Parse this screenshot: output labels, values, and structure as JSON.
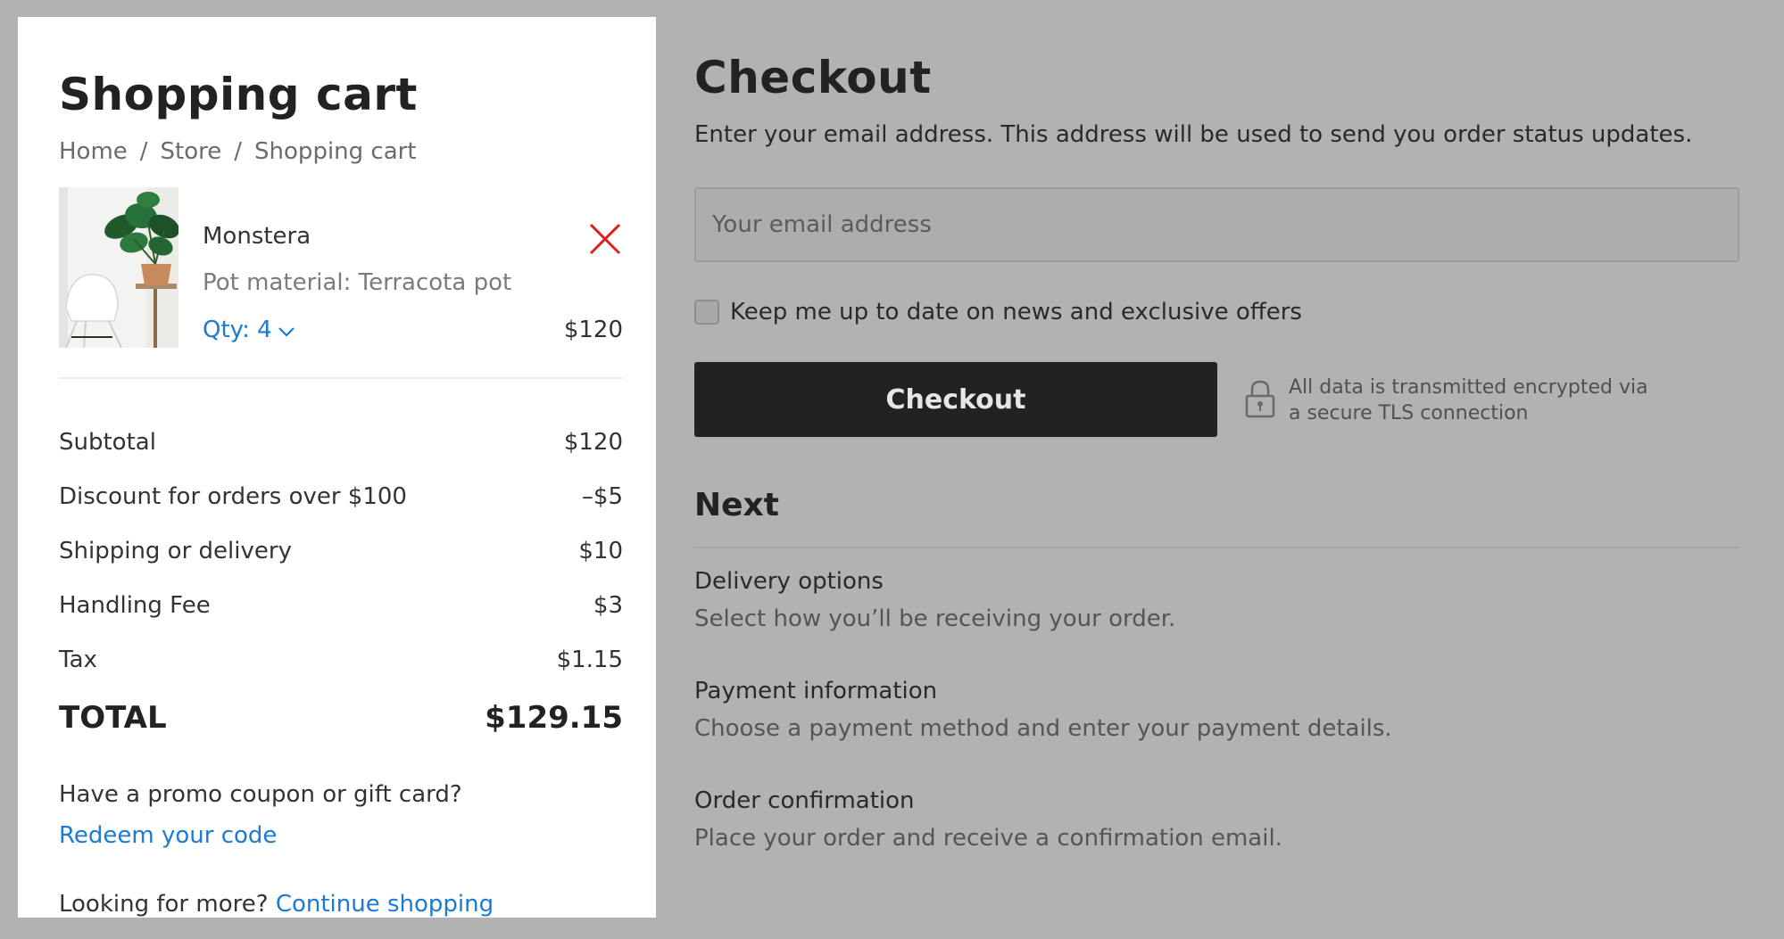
{
  "cart": {
    "title": "Shopping cart",
    "breadcrumb": [
      "Home",
      "Store",
      "Shopping cart"
    ],
    "breadcrumb_separator": "/",
    "item": {
      "name": "Monstera",
      "meta": "Pot material: Terracota pot",
      "qty": "Qty: 4",
      "price": "$120",
      "image": "monstera-plant-photo"
    },
    "summary": [
      {
        "label": "Subtotal",
        "value": "$120"
      },
      {
        "label": "Discount for orders over $100",
        "value": "–$5"
      },
      {
        "label": "Shipping or delivery",
        "value": "$10"
      },
      {
        "label": "Handling Fee",
        "value": "$3"
      },
      {
        "label": "Tax",
        "value": "$1.15"
      }
    ],
    "total": {
      "label": "TOTAL",
      "value": "$129.15"
    },
    "promo_question": "Have a promo coupon or gift card?",
    "redeem_link": "Redeem your code",
    "more_text": "Looking for more?",
    "continue_link": "Continue shopping"
  },
  "checkout": {
    "title": "Checkout",
    "description": "Enter your email address. This address will be used to send you order status updates.",
    "email_placeholder": "Your email address",
    "email_value": "",
    "newsletter_label": "Keep me up to date on news and exclusive offers",
    "newsletter_checked": false,
    "button_label": "Checkout",
    "secure_line1": "All data is transmitted encrypted via",
    "secure_line2": "a secure TLS connection",
    "next_title": "Next",
    "steps": [
      {
        "title": "Delivery options",
        "desc": "Select how you’ll be receiving your order."
      },
      {
        "title": "Payment information",
        "desc": "Choose a payment method and enter your payment details."
      },
      {
        "title": "Order confirmation",
        "desc": "Place your order and receive a confirmation email."
      }
    ]
  },
  "colors": {
    "overlay": "#b2b2b2",
    "link": "#1c7ad1",
    "remove": "#e0201e",
    "button": "#222222"
  },
  "icons": [
    "close-icon",
    "chevron-down-icon",
    "lock-icon"
  ]
}
